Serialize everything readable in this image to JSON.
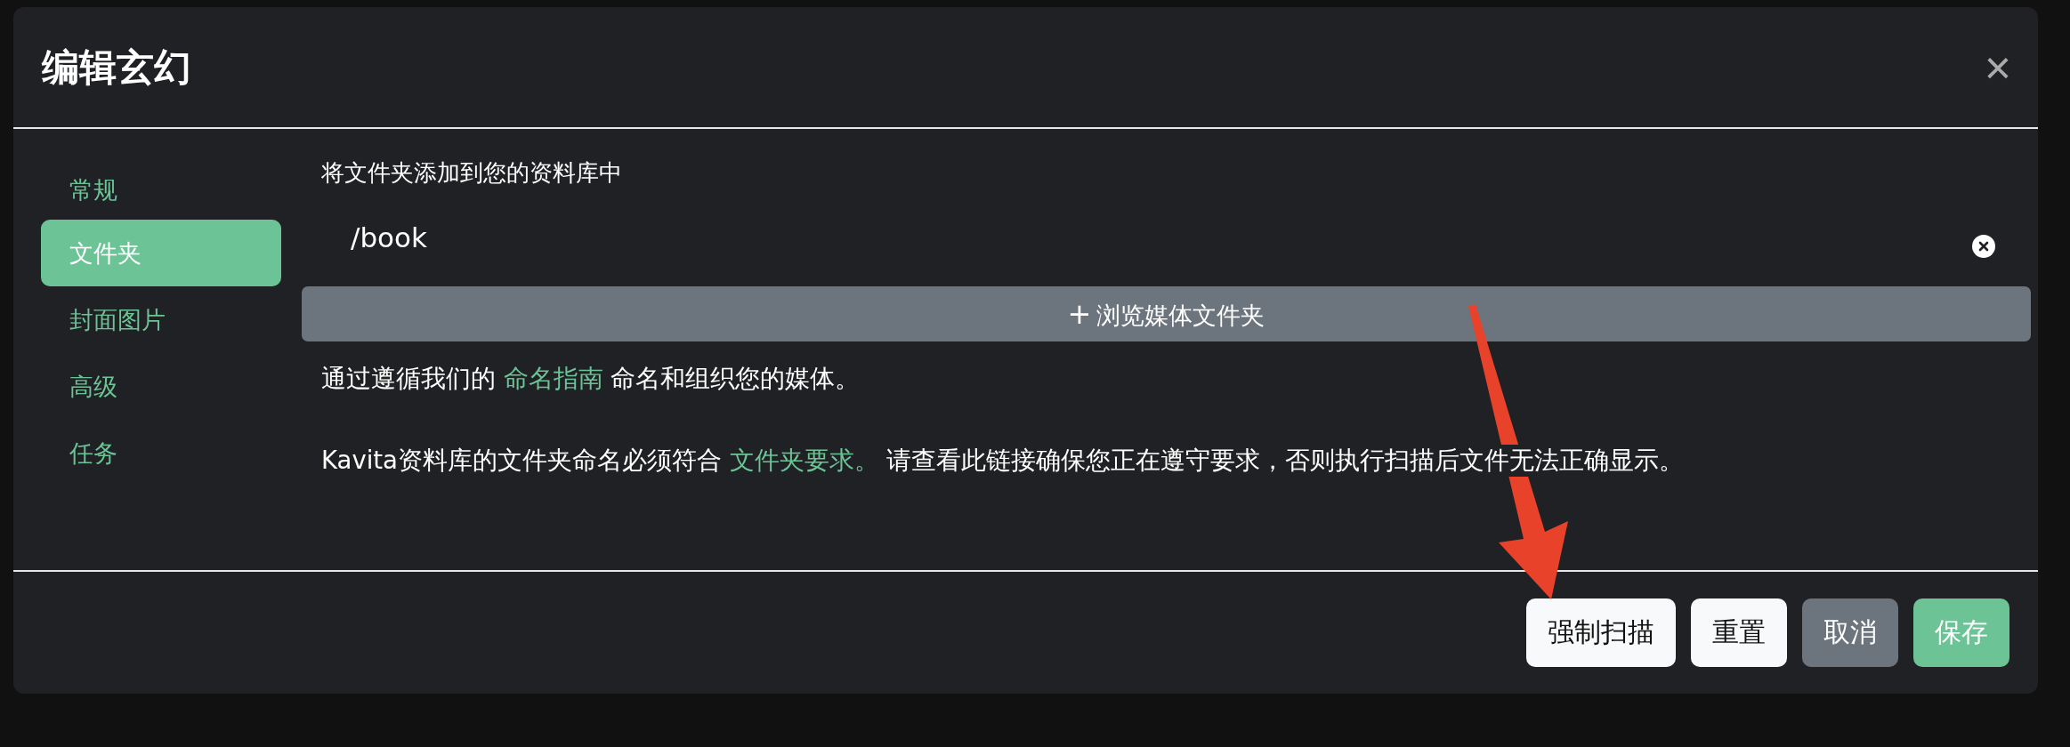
{
  "dialog": {
    "title": "编辑玄幻",
    "close": "×"
  },
  "sidebar": {
    "items": [
      {
        "label": "常规",
        "selected": false
      },
      {
        "label": "文件夹",
        "selected": true
      },
      {
        "label": "封面图片",
        "selected": false
      },
      {
        "label": "高级",
        "selected": false
      },
      {
        "label": "任务",
        "selected": false
      }
    ]
  },
  "folders": {
    "label": "将文件夹添加到您的资料库中",
    "paths": [
      {
        "value": "/book"
      }
    ],
    "browse_button": {
      "icon": "+",
      "label": "浏览媒体文件夹"
    }
  },
  "help": [
    [
      {
        "kind": "text",
        "text": "通过遵循我们的 "
      },
      {
        "kind": "link",
        "text": "命名指南"
      },
      {
        "kind": "text",
        "text": " 命名和组织您的媒体。"
      }
    ],
    [
      {
        "kind": "text",
        "text": "Kavita资料库的文件夹命名必须符合 "
      },
      {
        "kind": "link",
        "text": "文件夹要求。"
      },
      {
        "kind": "text",
        "text": " 请查看此链接确保您正在遵守要求，否则执行扫描后文件无法正确显示。"
      }
    ]
  ],
  "footer_buttons": [
    {
      "label": "强制扫描",
      "kind": "light"
    },
    {
      "label": "重置",
      "kind": "light"
    },
    {
      "label": "取消",
      "kind": "secondary"
    },
    {
      "label": "保存",
      "kind": "primary"
    }
  ]
}
